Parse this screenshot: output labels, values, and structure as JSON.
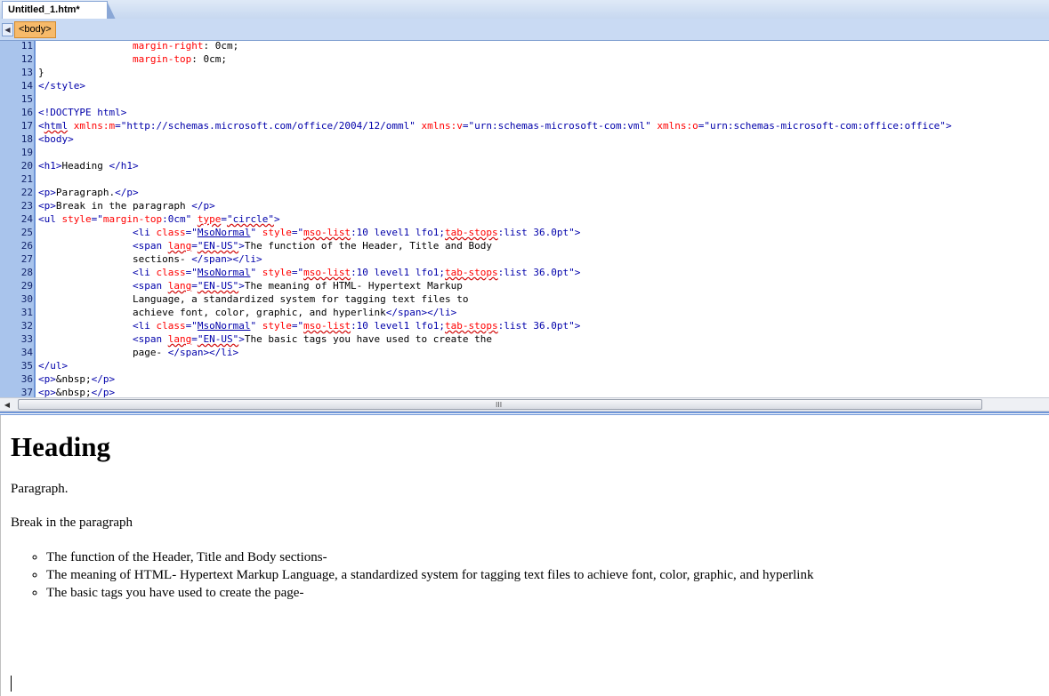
{
  "tab": {
    "title": "Untitled_1.htm*"
  },
  "tagbar": {
    "selected_tag": "<body>"
  },
  "editor": {
    "lines": [
      {
        "n": "11",
        "html": "                <span class=\"a\">margin-right</span>: 0cm;"
      },
      {
        "n": "12",
        "html": "                <span class=\"a\">margin-top</span>: 0cm;"
      },
      {
        "n": "13",
        "html": "}"
      },
      {
        "n": "14",
        "html": "<span class=\"t\">&lt;/style&gt;</span>"
      },
      {
        "n": "15",
        "html": ""
      },
      {
        "n": "16",
        "html": "<span class=\"t\">&lt;!DOCTYPE html&gt;</span>"
      },
      {
        "n": "17",
        "html": "<span class=\"t\">&lt;<span class=\"sq\">html</span> </span><span class=\"a\">xmlns:m</span><span class=\"t\">=</span><span class=\"v\">\"http://schemas.microsoft.com/office/2004/12/omml\"</span> <span class=\"a\">xmlns:v</span><span class=\"t\">=</span><span class=\"v\">\"urn:schemas-microsoft-com:vml\"</span> <span class=\"a\">xmlns:o</span><span class=\"t\">=</span><span class=\"v\">\"urn:schemas-microsoft-com:office:office\"</span><span class=\"t\">&gt;</span>"
      },
      {
        "n": "18",
        "html": "<span class=\"t\">&lt;body&gt;</span>"
      },
      {
        "n": "19",
        "html": ""
      },
      {
        "n": "20",
        "html": "<span class=\"t\">&lt;h1&gt;</span>Heading <span class=\"t\">&lt;/h1&gt;</span>"
      },
      {
        "n": "21",
        "html": ""
      },
      {
        "n": "22",
        "html": "<span class=\"t\">&lt;p&gt;</span>Paragraph.<span class=\"t\">&lt;/p&gt;</span>"
      },
      {
        "n": "23",
        "html": "<span class=\"t\">&lt;p&gt;</span>Break in the paragraph <span class=\"t\">&lt;/p&gt;</span>"
      },
      {
        "n": "24",
        "html": "<span class=\"t\">&lt;ul </span><span class=\"a\">style</span><span class=\"t\">=</span><span class=\"v\">\"</span><span class=\"a\">margin-top</span><span class=\"v\">:0cm\"</span> <span class=\"a sq\">type</span><span class=\"t\">=</span><span class=\"v sq\">\"circle\"</span><span class=\"t\">&gt;</span>"
      },
      {
        "n": "25",
        "html": "                <span class=\"t\">&lt;li </span><span class=\"a\">class</span><span class=\"t\">=</span><span class=\"v\">\"<span class=\"ul\">MsoNormal</span>\"</span> <span class=\"a\">style</span><span class=\"t\">=</span><span class=\"v\">\"</span><span class=\"a sq\">mso-list</span><span class=\"v\">:10 level1 lfo1;</span><span class=\"a sq\">tab-stops</span><span class=\"v\">:list 36.0pt\"</span><span class=\"t\">&gt;</span>"
      },
      {
        "n": "26",
        "html": "                <span class=\"t\">&lt;span </span><span class=\"a sq\">lang</span><span class=\"t\">=</span><span class=\"v sq\">\"EN-US\"</span><span class=\"t\">&gt;</span>The function of the Header, Title and Body"
      },
      {
        "n": "27",
        "html": "                sections- <span class=\"t\">&lt;/span&gt;&lt;/li&gt;</span>"
      },
      {
        "n": "28",
        "html": "                <span class=\"t\">&lt;li </span><span class=\"a\">class</span><span class=\"t\">=</span><span class=\"v\">\"<span class=\"ul\">MsoNormal</span>\"</span> <span class=\"a\">style</span><span class=\"t\">=</span><span class=\"v\">\"</span><span class=\"a sq\">mso-list</span><span class=\"v\">:10 level1 lfo1;</span><span class=\"a sq\">tab-stops</span><span class=\"v\">:list 36.0pt\"</span><span class=\"t\">&gt;</span>"
      },
      {
        "n": "29",
        "html": "                <span class=\"t\">&lt;span </span><span class=\"a sq\">lang</span><span class=\"t\">=</span><span class=\"v sq\">\"EN-US\"</span><span class=\"t\">&gt;</span>The meaning of HTML- Hypertext Markup"
      },
      {
        "n": "30",
        "html": "                Language, a standardized system for tagging text files to"
      },
      {
        "n": "31",
        "html": "                achieve font, color, graphic, and hyperlink<span class=\"t\">&lt;/span&gt;&lt;/li&gt;</span>"
      },
      {
        "n": "32",
        "html": "                <span class=\"t\">&lt;li </span><span class=\"a\">class</span><span class=\"t\">=</span><span class=\"v\">\"<span class=\"ul\">MsoNormal</span>\"</span> <span class=\"a\">style</span><span class=\"t\">=</span><span class=\"v\">\"</span><span class=\"a sq\">mso-list</span><span class=\"v\">:10 level1 lfo1;</span><span class=\"a sq\">tab-stops</span><span class=\"v\">:list 36.0pt\"</span><span class=\"t\">&gt;</span>"
      },
      {
        "n": "33",
        "html": "                <span class=\"t\">&lt;span </span><span class=\"a sq\">lang</span><span class=\"t\">=</span><span class=\"v sq\">\"EN-US\"</span><span class=\"t\">&gt;</span>The basic tags you have used to create the"
      },
      {
        "n": "34",
        "html": "                page- <span class=\"t\">&lt;/span&gt;&lt;/li&gt;</span>"
      },
      {
        "n": "35",
        "html": "<span class=\"t\">&lt;/ul&gt;</span>"
      },
      {
        "n": "36",
        "html": "<span class=\"t\">&lt;p&gt;</span>&amp;nbsp;<span class=\"t\">&lt;/p&gt;</span>"
      },
      {
        "n": "37",
        "html": "<span class=\"t\">&lt;p&gt;</span>&amp;nbsp;<span class=\"t\">&lt;/p&gt;</span>"
      }
    ]
  },
  "scrollbar": {
    "grip": "III"
  },
  "design": {
    "heading": "Heading",
    "para1": "Paragraph.",
    "para2": "Break in the paragraph",
    "items": [
      "The function of the Header, Title and Body sections-",
      "The meaning of HTML- Hypertext Markup Language, a standardized system for tagging text files to achieve font, color, graphic, and hyperlink",
      "The basic tags you have used to create the page-"
    ]
  },
  "colors": {
    "gutter": "#a9c4ec",
    "tag": "#0000aa",
    "attribute": "#ff0000",
    "selected_tag_chip": "#f7ba6a"
  }
}
